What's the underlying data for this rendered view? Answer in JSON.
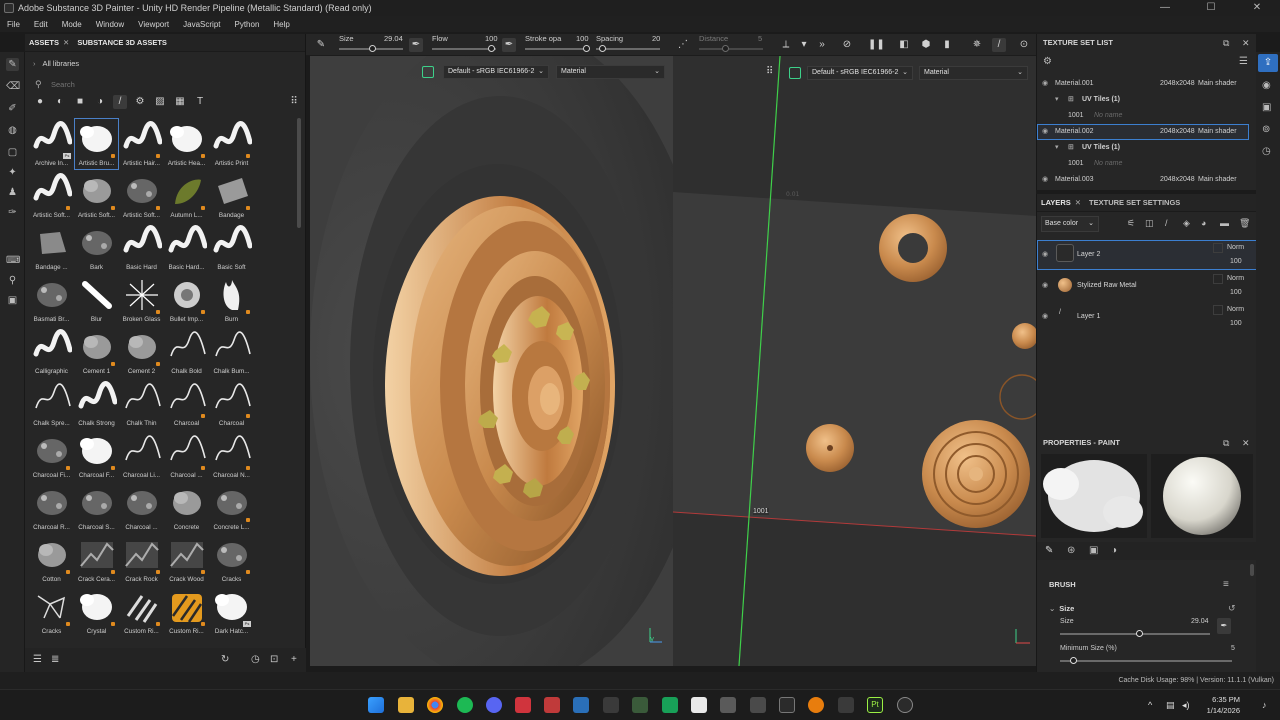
{
  "window": {
    "title": "Adobe Substance 3D Painter - Unity HD Render Pipeline (Metallic Standard) (Read only)",
    "min": "—",
    "max": "☐",
    "close": "✕"
  },
  "menu": [
    "File",
    "Edit",
    "Mode",
    "Window",
    "Viewport",
    "JavaScript",
    "Python",
    "Help"
  ],
  "assets_panel": {
    "tab_assets": "ASSETS",
    "tab_substance": "SUBSTANCE 3D ASSETS",
    "all_libraries": "All libraries",
    "search_placeholder": "Search",
    "items": [
      "Archive In...",
      "Artistic Bru...",
      "Artistic Hair...",
      "Artistic Hea...",
      "Artistic Print",
      "Artistic Soft...",
      "Artistic Soft...",
      "Artistic Soft...",
      "Autumn L...",
      "Bandage",
      "Bandage ...",
      "Bark",
      "Basic Hard",
      "Basic Hard...",
      "Basic Soft",
      "Basmati Br...",
      "Blur",
      "Broken Glass",
      "Bullet Imp...",
      "Burn",
      "Calligraphic",
      "Cement 1",
      "Cement 2",
      "Chalk Bold",
      "Chalk Bum...",
      "Chalk Spre...",
      "Chalk Strong",
      "Chalk Thin",
      "Charcoal",
      "Charcoal",
      "Charcoal Fi...",
      "Charcoal F...",
      "Charcoal Li...",
      "Charcoal ...",
      "Charcoal N...",
      "Charcoal R...",
      "Charcoal S...",
      "Charcoal ...",
      "Concrete",
      "Concrete L...",
      "Cotton",
      "Crack Cera...",
      "Crack Rock",
      "Crack Wood",
      "Cracks",
      "Cracks",
      "Crystal",
      "Custom Ri...",
      "Custom Ri...",
      "Dark Hatc..."
    ],
    "ps_badge": "Ps"
  },
  "toolbar": {
    "size_label": "Size",
    "size_value": "29.04",
    "flow_label": "Flow",
    "flow_value": "100",
    "stroke_label": "Stroke opa",
    "stroke_value": "100",
    "spacing_label": "Spacing",
    "spacing_value": "20",
    "distance_label": "Distance",
    "distance_value": "5"
  },
  "viewport": {
    "colorspace_left": "Default - sRGB IEC61966-2",
    "channel_left": "Material",
    "colorspace_right": "Default - sRGB IEC61966-2",
    "channel_right": "Material",
    "uv_label": "1001"
  },
  "texture_set_list": {
    "title": "TEXTURE SET LIST",
    "rows": [
      {
        "name": "Material.001",
        "res": "2048x2048",
        "shader": "Main shader"
      },
      {
        "name": "UV Tiles (1)"
      },
      {
        "name": "1001",
        "placeholder": "No name"
      },
      {
        "name": "Material.002",
        "res": "2048x2048",
        "shader": "Main shader"
      },
      {
        "name": "UV Tiles (1)"
      },
      {
        "name": "1001",
        "placeholder": "No name"
      },
      {
        "name": "Material.003",
        "res": "2048x2048",
        "shader": "Main shader"
      }
    ]
  },
  "layers": {
    "tab_layers": "LAYERS",
    "tab_tss": "TEXTURE SET SETTINGS",
    "channel": "Base color",
    "items": [
      {
        "name": "Layer 2",
        "blend": "Norm",
        "opacity": "100"
      },
      {
        "name": "Stylized Raw Metal",
        "blend": "Norm",
        "opacity": "100"
      },
      {
        "name": "Layer 1",
        "blend": "Norm",
        "opacity": "100"
      }
    ]
  },
  "properties": {
    "title": "PROPERTIES - PAINT",
    "brush_label": "BRUSH",
    "size_group": "Size",
    "size_label": "Size",
    "size_value": "29.04",
    "min_size_label": "Minimum Size (%)",
    "min_size_value": "5"
  },
  "status": {
    "text": "Cache Disk Usage:  98% | Version: 11.1.1 (Vulkan)"
  },
  "taskbar": {
    "time": "6:35 PM",
    "date": "1/14/2026"
  },
  "colors": {
    "accent": "#3c7fd0",
    "copper": "#c98a4d",
    "badge": "#e08a1e"
  }
}
